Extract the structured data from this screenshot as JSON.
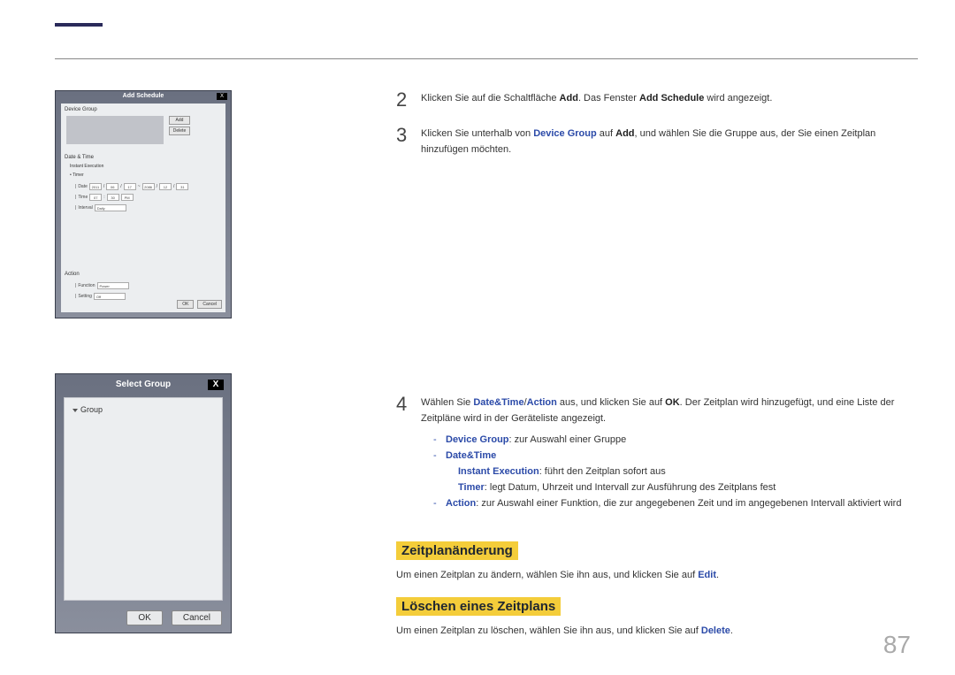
{
  "page_number": "87",
  "screenshot1": {
    "title": "Add Schedule",
    "close": "X",
    "device_group_label": "Device Group",
    "add_btn": "Add",
    "delete_btn": "Delete",
    "datetime_label": "Date & Time",
    "instant_exec": "Instant Execution",
    "timer_label": "Timer",
    "date_label": "Date",
    "date_y1": "2011",
    "date_m1": "06",
    "date_d1": "17",
    "date_y2": "2086",
    "date_m2": "12",
    "date_d2": "31",
    "time_label": "Time",
    "time_h": "07",
    "time_m": "30",
    "time_ampm": "PM",
    "interval_label": "Interval",
    "interval_val": "Daily",
    "action_label": "Action",
    "function_label": "Function",
    "function_val": "Power",
    "setting_label": "Setting",
    "setting_val": "Off",
    "ok": "OK",
    "cancel": "Cancel"
  },
  "screenshot2": {
    "title": "Select Group",
    "close": "X",
    "group_label": "Group",
    "ok": "OK",
    "cancel": "Cancel"
  },
  "steps": {
    "s2": {
      "num": "2",
      "t1": "Klicken Sie auf die Schaltfläche ",
      "b1": "Add",
      "t2": ". Das Fenster ",
      "b2": "Add Schedule",
      "t3": " wird angezeigt."
    },
    "s3": {
      "num": "3",
      "t1": "Klicken Sie unterhalb von ",
      "b1": "Device Group",
      "t2": " auf ",
      "b2": "Add",
      "t3": ", und wählen Sie die Gruppe aus, der Sie einen Zeitplan hinzufügen möchten."
    },
    "s4": {
      "num": "4",
      "t1": "Wählen Sie ",
      "b1": "Date&Time",
      "t2": "/",
      "b2": "Action",
      "t3": " aus, und klicken Sie auf ",
      "b3": "OK",
      "t4": ". Der Zeitplan wird hinzugefügt, und eine Liste der Zeitpläne wird in der Geräteliste angezeigt.",
      "bullets": {
        "dg_label": "Device Group",
        "dg_text": ": zur Auswahl einer Gruppe",
        "dt_label": "Date&Time",
        "ie_label": "Instant Execution",
        "ie_text": ": führt den Zeitplan sofort aus",
        "tm_label": "Timer",
        "tm_text": ": legt Datum, Uhrzeit und Intervall zur Ausführung des Zeitplans fest",
        "ac_label": "Action",
        "ac_text": ": zur Auswahl einer Funktion, die zur angegebenen Zeit und im angegebenen Intervall aktiviert wird"
      }
    }
  },
  "sections": {
    "change": {
      "heading": "Zeitplanänderung",
      "t1": "Um einen Zeitplan zu ändern, wählen Sie ihn aus, und klicken Sie auf ",
      "b1": "Edit",
      "t2": "."
    },
    "delete": {
      "heading": "Löschen eines Zeitplans",
      "t1": "Um einen Zeitplan zu löschen, wählen Sie ihn aus, und klicken Sie auf ",
      "b1": "Delete",
      "t2": "."
    }
  }
}
